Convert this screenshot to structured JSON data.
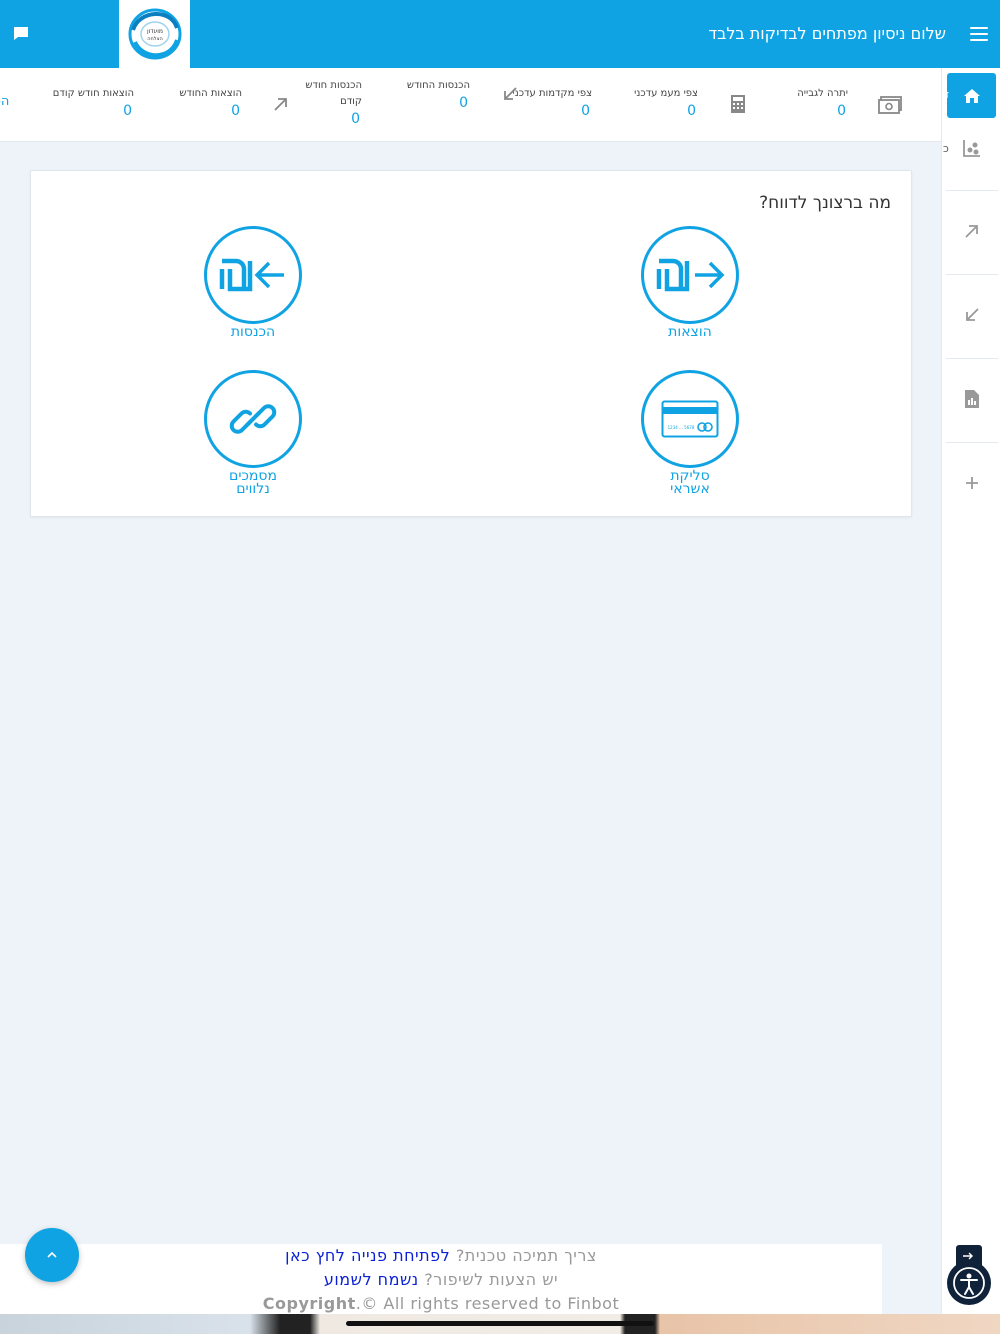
{
  "header": {
    "greeting": "שלום ניסיון מפתחים לבדיקות בלבד",
    "logo_text": "מועדון הצלחה"
  },
  "stats": [
    {
      "label": "יתרה לגבייה",
      "value": "0",
      "icon": "money-icon"
    },
    {
      "label": "צפי מעמ עדכני",
      "value": "0",
      "icon": "calculator-icon"
    },
    {
      "label": "צפי מקדמות עדכני",
      "value": "0",
      "icon": "arrow-down-left-icon"
    },
    {
      "label": "הכנסות החודש",
      "value": "0"
    },
    {
      "label": "הכנסות חודש קודם",
      "value": "0",
      "icon": "arrow-up-right-icon"
    },
    {
      "label": "הוצאות החודש",
      "value": "0"
    },
    {
      "label": "הוצאות חודש קודם",
      "value": "0"
    }
  ],
  "stats_cut_label": "הכ",
  "sidebar": {
    "slivers": [
      "ד",
      "כ"
    ],
    "items": [
      "home-icon",
      "chart-people-icon",
      "arrow-up-right-icon",
      "arrow-down-left-icon",
      "document-chart-icon",
      "plus-icon"
    ]
  },
  "card": {
    "title": "מה ברצונך לדווח?",
    "tiles": [
      {
        "label": "הוצאות",
        "icon": "shekel-arrow-out-icon"
      },
      {
        "label": "הכנסות",
        "icon": "shekel-arrow-in-icon"
      },
      {
        "label_line1": "סליקת",
        "label_line2": "אשראי",
        "icon": "credit-card-icon"
      },
      {
        "label_line1": "מסמכים",
        "label_line2": "נלווים",
        "icon": "link-icon"
      }
    ],
    "card_icon_text": {
      "left": "1234 ... 5678"
    }
  },
  "footer": {
    "support_q": "צריך תמיכה טכנית?",
    "support_link": "לפתיחת פנייה לחץ כאן",
    "suggest_q": "יש הצעות לשיפור?",
    "suggest_link": "נשמח לשמוע",
    "copyright_word": "Copyright",
    "copyright_rest": "© All rights reserved to Finbot"
  },
  "colors": {
    "primary": "#10a3e3",
    "link": "#0a1fd6",
    "background": "#edf3f8"
  }
}
